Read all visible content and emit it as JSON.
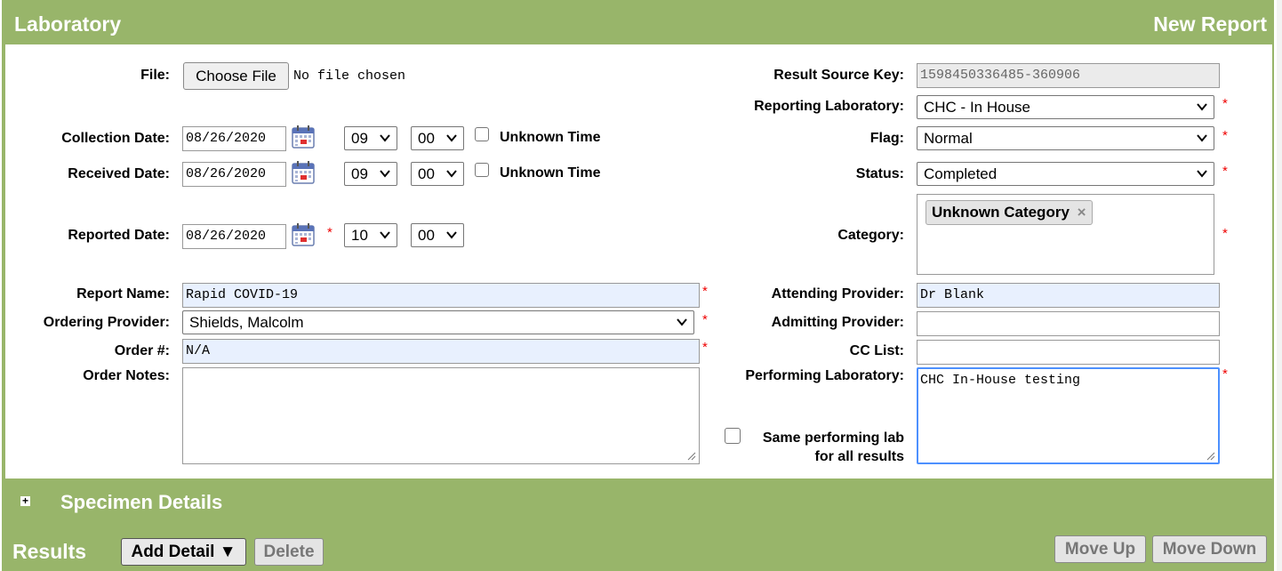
{
  "header": {
    "title": "Laboratory",
    "mode": "New Report"
  },
  "form": {
    "file": {
      "label": "File:",
      "button": "Choose File",
      "status": "No file chosen"
    },
    "collection": {
      "label": "Collection Date:",
      "date": "08/26/2020",
      "hour": "09",
      "minute": "00",
      "unknown_label": "Unknown Time"
    },
    "received": {
      "label": "Received Date:",
      "date": "08/26/2020",
      "hour": "09",
      "minute": "00",
      "unknown_label": "Unknown Time"
    },
    "reported": {
      "label": "Reported Date:",
      "date": "08/26/2020",
      "hour": "10",
      "minute": "00",
      "required": "*"
    },
    "report_name": {
      "label": "Report Name:",
      "value": "Rapid COVID-19",
      "required": "*"
    },
    "ordering_provider": {
      "label": "Ordering Provider:",
      "value": "Shields, Malcolm",
      "required": "*"
    },
    "order_number": {
      "label": "Order #:",
      "value": "N/A",
      "required": "*"
    },
    "order_notes": {
      "label": "Order Notes:",
      "value": ""
    },
    "result_source_key": {
      "label": "Result Source Key:",
      "value": "1598450336485-360906"
    },
    "reporting_lab": {
      "label": "Reporting Laboratory:",
      "value": "CHC - In House",
      "required": "*"
    },
    "flag": {
      "label": "Flag:",
      "value": "Normal",
      "required": "*"
    },
    "status": {
      "label": "Status:",
      "value": "Completed",
      "required": "*"
    },
    "category": {
      "label": "Category:",
      "tag": "Unknown Category",
      "remove": "×",
      "required": "*"
    },
    "attending_provider": {
      "label": "Attending Provider:",
      "value": "Dr Blank"
    },
    "admitting_provider": {
      "label": "Admitting Provider:",
      "value": ""
    },
    "cc_list": {
      "label": "CC List:",
      "value": ""
    },
    "performing_lab": {
      "label": "Performing Laboratory:",
      "value": "CHC In-House testing",
      "required": "*"
    },
    "same_lab": {
      "label_line1": "Same performing lab",
      "label_line2": "for all results"
    }
  },
  "specimen": {
    "toggle": "+",
    "title": "Specimen Details"
  },
  "results": {
    "title": "Results",
    "add_detail": "Add Detail ▼",
    "delete": "Delete",
    "move_up": "Move Up",
    "move_down": "Move Down"
  },
  "colors": {
    "header_green": "#98b56a",
    "required_red": "#e00000",
    "autofill_blue": "#e8f0fe",
    "focus_blue": "#4d90fe"
  },
  "icons": {
    "calendar": "calendar-icon",
    "chevron": "chevron-down-icon",
    "expand": "expand-plus-icon"
  }
}
